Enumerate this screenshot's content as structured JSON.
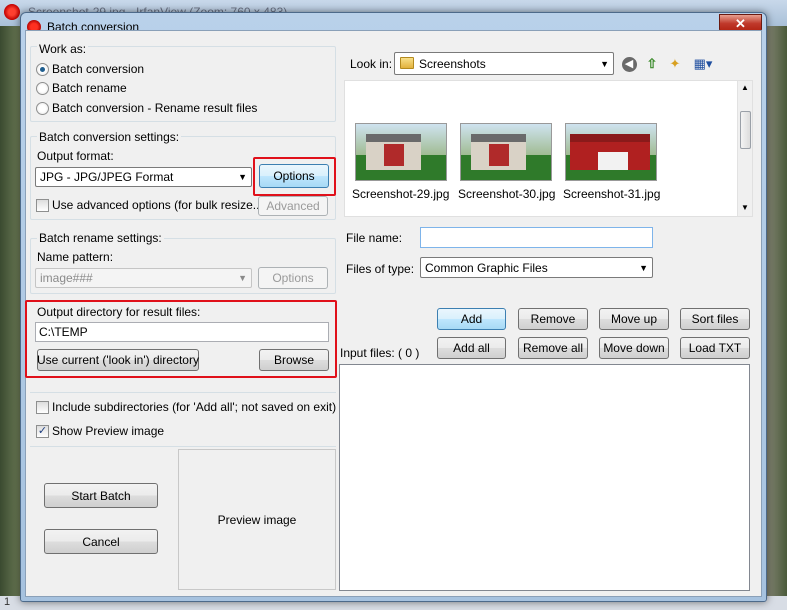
{
  "background": {
    "title": "Screenshot-29.jpg - IrfanView (Zoom: 760 x 483)",
    "status_text": "1"
  },
  "dialog": {
    "title": "Batch conversion",
    "close_label": "✕"
  },
  "work_as": {
    "legend": "Work as:",
    "options": [
      {
        "label": "Batch conversion",
        "selected": true
      },
      {
        "label": "Batch rename",
        "selected": false
      },
      {
        "label": "Batch conversion - Rename result files",
        "selected": false
      }
    ]
  },
  "conversion_settings": {
    "legend": "Batch conversion settings:",
    "output_format_label": "Output format:",
    "output_format_value": "JPG - JPG/JPEG Format",
    "options_button": "Options",
    "advanced_checkbox": "Use advanced options (for bulk resize...)",
    "advanced_checked": false,
    "advanced_button": "Advanced"
  },
  "rename_settings": {
    "legend": "Batch rename settings:",
    "name_pattern_label": "Name pattern:",
    "name_pattern_value": "image###",
    "options_button": "Options"
  },
  "output_dir": {
    "legend": "Output directory for result files:",
    "value": "C:\\TEMP",
    "use_current_button": "Use current ('look in') directory",
    "browse_button": "Browse"
  },
  "include_subdirs": {
    "label": "Include subdirectories (for 'Add all'; not saved on exit)",
    "checked": false
  },
  "show_preview": {
    "label": "Show Preview image",
    "checked": true
  },
  "start_batch_button": "Start Batch",
  "cancel_button": "Cancel",
  "preview_label": "Preview image",
  "file_browser": {
    "look_in_label": "Look in:",
    "look_in_value": "Screenshots",
    "files": [
      {
        "name": "Screenshot-29.jpg"
      },
      {
        "name": "Screenshot-30.jpg"
      },
      {
        "name": "Screenshot-31.jpg"
      }
    ],
    "file_name_label": "File name:",
    "file_name_value": "",
    "files_of_type_label": "Files of type:",
    "files_of_type_value": "Common Graphic Files"
  },
  "actions": {
    "add": "Add",
    "remove": "Remove",
    "move_up": "Move up",
    "sort_files": "Sort files",
    "add_all": "Add all",
    "remove_all": "Remove all",
    "move_down": "Move down",
    "load_txt": "Load TXT"
  },
  "input_files_label": "Input files: ( 0 )",
  "highlight_color": "#e0101a"
}
